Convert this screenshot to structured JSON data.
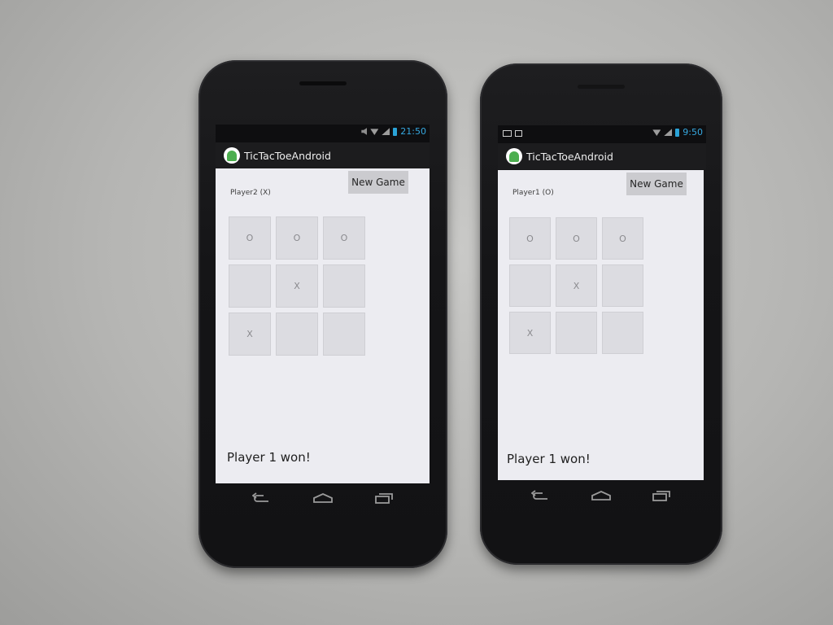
{
  "phones": [
    {
      "status": {
        "time": "21:50"
      },
      "action_bar": {
        "app_title": "TicTacToeAndroid"
      },
      "game": {
        "new_game_label": "New Game",
        "player_label": "Player2 (X)",
        "board": [
          "O",
          "O",
          "O",
          "",
          "X",
          "",
          "X",
          "",
          ""
        ],
        "result": "Player 1 won!"
      }
    },
    {
      "status": {
        "time": "9:50"
      },
      "action_bar": {
        "app_title": "TicTacToeAndroid"
      },
      "game": {
        "new_game_label": "New Game",
        "player_label": "Player1 (O)",
        "board": [
          "O",
          "O",
          "O",
          "",
          "X",
          "",
          "X",
          "",
          ""
        ],
        "result": "Player 1 won!"
      }
    }
  ],
  "colors": {
    "clock": "#36a8e0",
    "screen_bg": "#ececf1",
    "cell_bg": "#dcdce1",
    "button_bg": "#cbcbcf",
    "android_green": "#4cae4f"
  },
  "icons": {
    "status_left_right_phone": [
      "gmail-icon",
      "play-store-icon"
    ],
    "status_right": [
      "mute-icon",
      "wifi-icon",
      "signal-icon",
      "battery-icon"
    ],
    "nav": [
      "back-icon",
      "home-icon",
      "recent-apps-icon"
    ]
  }
}
